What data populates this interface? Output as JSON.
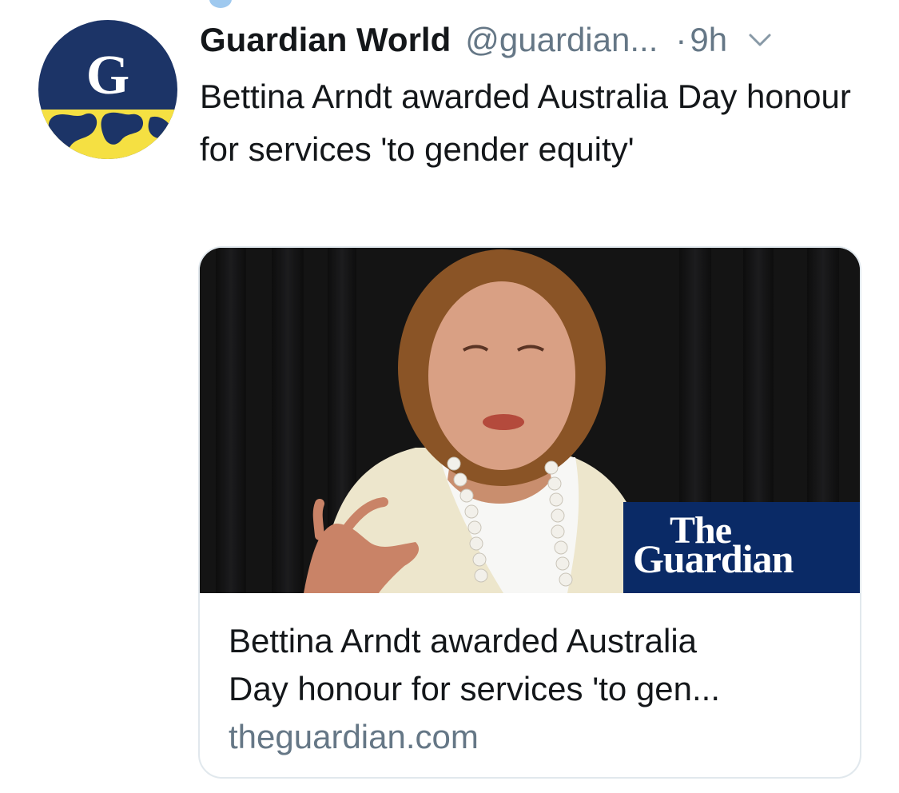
{
  "tweet": {
    "author_name": "Guardian World",
    "handle": "@guardian...",
    "separator": "·",
    "time": "9h",
    "text": "Bettina Arndt awarded Australia Day honour for services 'to gender equity'"
  },
  "avatar": {
    "letter": "G",
    "colors": {
      "navy": "#1c3467",
      "yellow": "#f5e042"
    }
  },
  "card": {
    "title_line1": "Bettina Arndt awarded Australia",
    "title_line2": "Day honour for services 'to gen...",
    "domain": "theguardian.com",
    "logo_the": "The",
    "logo_guardian": "Guardian"
  },
  "colors": {
    "text": "#14171a",
    "secondary": "#657786",
    "border": "#e1e8ed",
    "guardian_blue": "#0a2a66"
  },
  "icons": [
    "chevron-down-icon"
  ]
}
